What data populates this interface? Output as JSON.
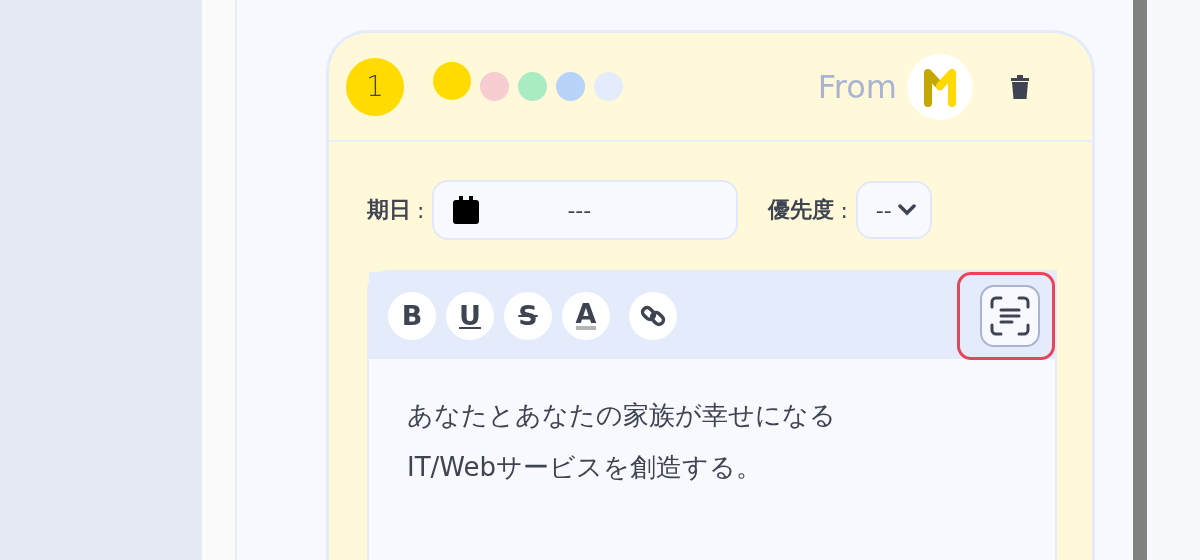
{
  "card": {
    "number": "1",
    "colors": [
      {
        "color": "#ffdb00",
        "selected": true
      },
      {
        "color": "#f7cdd1",
        "selected": false
      },
      {
        "color": "#a9ebc2",
        "selected": false
      },
      {
        "color": "#b8d3fa",
        "selected": false
      },
      {
        "color": "#e4ecfc",
        "selected": false
      }
    ],
    "from_label": "From",
    "due": {
      "label": "期日",
      "separator": ":",
      "value": "---"
    },
    "priority": {
      "label": "優先度",
      "separator": ":",
      "value": "--"
    },
    "toolbar": [
      {
        "kind": "bold",
        "label": "B"
      },
      {
        "kind": "underline",
        "label": "U"
      },
      {
        "kind": "strike",
        "label": "S"
      },
      {
        "kind": "color",
        "label": "A"
      },
      {
        "kind": "link"
      }
    ],
    "format_button": {
      "highlighted": true
    },
    "body": [
      "あなたとあなたの家族が幸せになる",
      "IT/Webサービスを創造する。"
    ]
  }
}
